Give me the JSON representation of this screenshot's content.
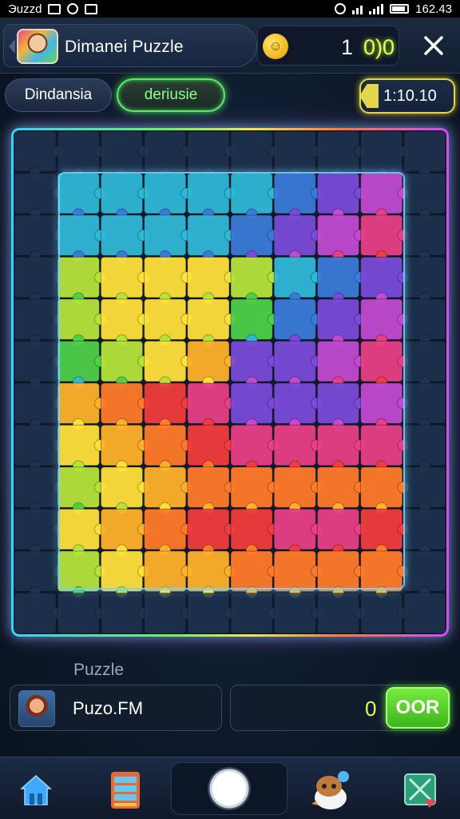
{
  "status_bar": {
    "carrier": "Эuzzd",
    "time": "162.43"
  },
  "header": {
    "title": "Dimanei Puzzle",
    "score": "1",
    "coins": "0)0"
  },
  "tabs": {
    "primary": "Dindansia",
    "secondary": "deriusie"
  },
  "timer": {
    "value": "1:10.10"
  },
  "board": {
    "frame_colors": [
      "#2fd6ff",
      "#6cf06a",
      "#f3e84a",
      "#ff7a3c",
      "#d44aff"
    ]
  },
  "footer": {
    "section_label": "Puzzle",
    "player_name": "Puzo.FM",
    "count": "0",
    "action_label": "OOR"
  },
  "nav": {
    "icons": [
      "home-icon",
      "list-icon",
      "center-button",
      "mascot-icon",
      "share-icon"
    ]
  },
  "colors": {
    "accent_green": "#58d92c",
    "accent_yellow": "#e8ff4a",
    "background": "#0e1a2c"
  }
}
